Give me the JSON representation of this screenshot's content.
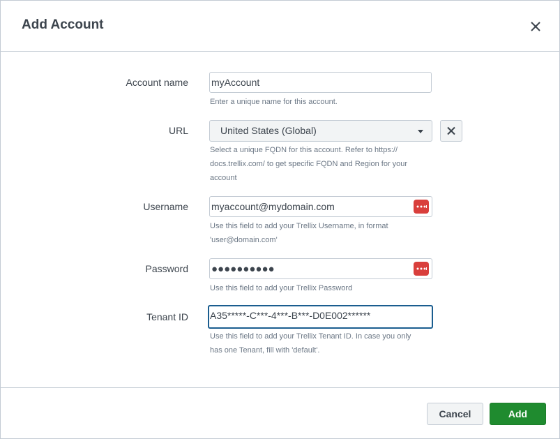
{
  "dialog": {
    "title": "Add Account",
    "close_icon": "close-icon"
  },
  "form": {
    "account_name": {
      "label": "Account name",
      "value": "myAccount",
      "help": "Enter a unique name for this account."
    },
    "url": {
      "label": "URL",
      "selected": "United States (Global)",
      "help_lines": [
        "Select a unique FQDN for this account. Refer to https://",
        "docs.trellix.com/ to get specific FQDN and Region for your",
        "account"
      ],
      "clear_icon": "close-icon"
    },
    "username": {
      "label": "Username",
      "value": "myaccount@mydomain.com",
      "help_lines": [
        "Use this field to add your Trellix Username, in format",
        "'user@domain.com'"
      ],
      "manager_icon": "password-manager-icon"
    },
    "password": {
      "label": "Password",
      "value": "●●●●●●●●●●",
      "help": "Use this field to add your Trellix Password",
      "manager_icon": "password-manager-icon"
    },
    "tenant_id": {
      "label": "Tenant ID",
      "value": "A35*****-C***-4***-B***-D0E002******",
      "help_lines": [
        "Use this field to add your Trellix Tenant ID. In case you only",
        "has one Tenant, fill with 'default'."
      ]
    }
  },
  "footer": {
    "cancel_label": "Cancel",
    "add_label": "Add"
  },
  "colors": {
    "primary_green": "#1f8b2f",
    "focus_blue": "#1a5d8f",
    "password_icon_red": "#d93f3c"
  }
}
